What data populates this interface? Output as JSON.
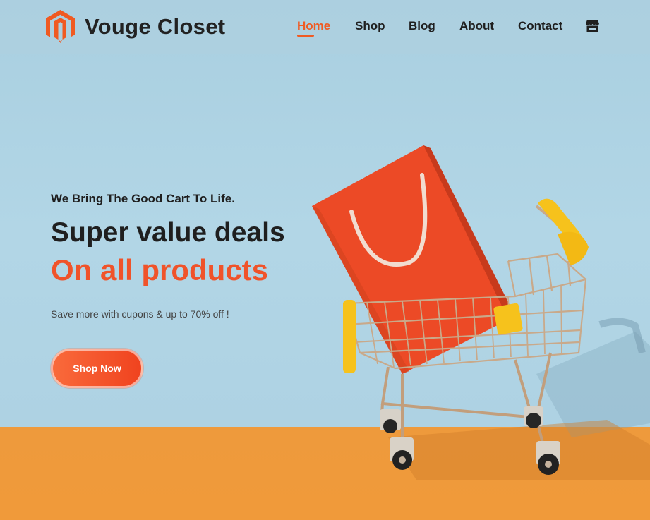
{
  "brand": {
    "name": "Vouge Closet",
    "logo_icon": "magento-style-logo-icon",
    "logo_color": "#f05a22"
  },
  "nav": {
    "items": [
      {
        "label": "Home",
        "active": true
      },
      {
        "label": "Shop",
        "active": false
      },
      {
        "label": "Blog",
        "active": false
      },
      {
        "label": "About",
        "active": false
      },
      {
        "label": "Contact",
        "active": false
      }
    ],
    "cart_icon": "store-icon"
  },
  "hero": {
    "tagline": "We Bring The Good Cart To Life.",
    "headline": "Super value deals",
    "headline_accent": "On all products",
    "subtext": "Save more with cupons & up to 70% off !",
    "cta_label": "Shop Now",
    "image": "shopping-cart-with-red-bag"
  },
  "colors": {
    "accent": "#f05a22",
    "wall": "#afd3e2",
    "floor": "#f09a3a",
    "text": "#1f1f1f"
  }
}
